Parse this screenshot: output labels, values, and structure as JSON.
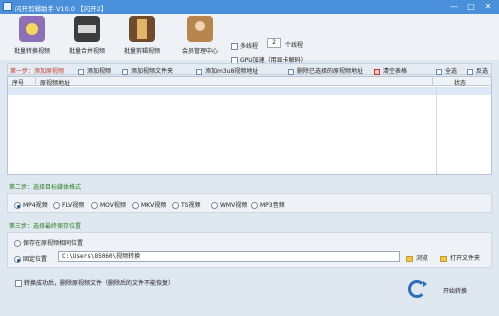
{
  "window": {
    "title": "闪开剪辑助手 V10.0 【闪开2】",
    "controls": [
      "—",
      "□",
      "✕"
    ]
  },
  "toolbar": {
    "tools": [
      {
        "label": "批量转换视频",
        "icon": "video-convert-icon"
      },
      {
        "label": "批量合并视频",
        "icon": "video-merge-icon"
      },
      {
        "label": "批量剪辑视频",
        "icon": "film-cut-icon"
      },
      {
        "label": "会员管理中心",
        "icon": "member-icon"
      }
    ],
    "multithread_label": "多线程",
    "thread_count": "2",
    "thread_suffix": "个线程",
    "gpu_label": "GPU加速（用显卡解码）"
  },
  "step1": {
    "label": "第一步：添加原视频",
    "actions": [
      "添加视频",
      "添加视频文件夹",
      "添加m3u8视频地址",
      "删除已选择的原视频地址",
      "清空表格",
      "全选",
      "反选"
    ],
    "columns": [
      "序号",
      "原视频地址",
      "状态"
    ]
  },
  "step2": {
    "label": "第二步：选择目标媒体格式",
    "formats": [
      "MP4视频",
      "FLV视频",
      "MOV视频",
      "MKV视频",
      "TS视频",
      "WMV视频",
      "MP3音频"
    ],
    "selected": "MP4视频"
  },
  "step3": {
    "label": "第三步：选择最终保存位置",
    "option_original": "保存在原视频相同位置",
    "option_fixed": "固定位置",
    "path": "C:\\Users\\85060\\视频转换",
    "browse_label": "浏览",
    "open_folder_label": "打开文件夹"
  },
  "delete_after": "转换成功后，删除原视频文件（删除后的文件不能恢复）",
  "start_label": "开始转换",
  "colors": {
    "titlebar": "#4a8fd9",
    "step_active": "#c0392b",
    "step": "#2e7d1e"
  }
}
